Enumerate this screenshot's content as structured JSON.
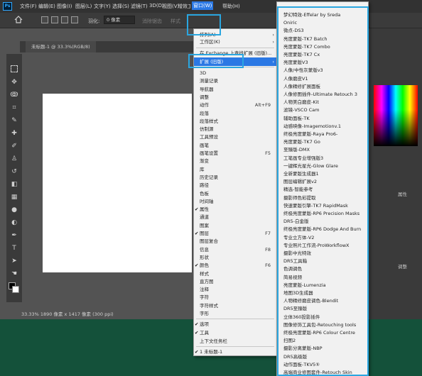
{
  "app": {
    "logo": "Ps"
  },
  "menubar": [
    "文件(F)",
    "编辑(E)",
    "图像(I)",
    "图层(L)",
    "文字(Y)",
    "选择(S)",
    "滤镜(T)",
    "3D(D)",
    "视图(V)",
    "增效工具",
    "窗口(W)",
    "帮助(H)"
  ],
  "options": {
    "feather_label": "羽化:",
    "feather_value": "0 像素",
    "antialias": "消除锯齿",
    "style": "样式"
  },
  "document": {
    "tab": "未标题-1 @ 33.3%(RGB/8)",
    "status": "33.33% 1890 像素 x 1417 像素 (300 ppi)"
  },
  "icons": [
    "home-icon",
    "marquee-icon",
    "move-icon",
    "lasso-icon",
    "crop-icon",
    "eyedropper-icon",
    "brush-icon",
    "stamp-icon",
    "eraser-icon",
    "gradient-icon",
    "pen-icon",
    "type-icon",
    "hand-icon",
    "zoom-icon"
  ],
  "right_panel": {
    "label": "属性",
    "label2": "调整"
  },
  "window_menu": {
    "top": [
      {
        "label": "排列(A)",
        "arrow": "›"
      },
      {
        "label": "工作区(K)",
        "arrow": "›"
      },
      {
        "label": "在 Exchange 上查找扩展 (旧版)..."
      },
      {
        "label": "扩展 (旧版)",
        "arrow": "›",
        "highlight": true
      }
    ],
    "panels": [
      {
        "label": "3D"
      },
      {
        "label": "测量记录"
      },
      {
        "label": "导航器"
      },
      {
        "label": "调整"
      },
      {
        "label": "动作",
        "shortcut": "Alt+F9"
      },
      {
        "label": "段落"
      },
      {
        "label": "段落样式"
      },
      {
        "label": "仿制源"
      },
      {
        "label": "工具预设"
      },
      {
        "label": "画笔"
      },
      {
        "label": "画笔设置",
        "shortcut": "F5"
      },
      {
        "label": "渐变"
      },
      {
        "label": "库"
      },
      {
        "label": "历史记录"
      },
      {
        "label": "路径"
      },
      {
        "label": "色板"
      },
      {
        "label": "时间轴"
      },
      {
        "label": "属性",
        "checked": true
      },
      {
        "label": "通道"
      },
      {
        "label": "图案"
      },
      {
        "label": "图层",
        "shortcut": "F7",
        "checked": true
      },
      {
        "label": "图层复合"
      },
      {
        "label": "信息",
        "shortcut": "F8"
      },
      {
        "label": "形状"
      },
      {
        "label": "颜色",
        "shortcut": "F6",
        "checked": true
      },
      {
        "label": "样式"
      },
      {
        "label": "直方图"
      },
      {
        "label": "注释"
      },
      {
        "label": "字符"
      },
      {
        "label": "字符样式"
      },
      {
        "label": "字形"
      }
    ],
    "bottom": [
      {
        "label": "选项",
        "checked": true
      },
      {
        "label": "工具",
        "checked": true
      },
      {
        "label": "上下文任务栏"
      }
    ],
    "docs": [
      {
        "label": "1 未标题-1",
        "checked": true
      }
    ],
    "check": "✔"
  },
  "extensions_menu": [
    "梦幻特效-Effelar by Sreda",
    "Oniric",
    "微点-DS3",
    "亮度蒙版-TK7 Batch",
    "亮度蒙版-TK7 Combo",
    "亮度蒙版-TK7 Cx",
    "亮度蒙版V3",
    "人像/中性灰蒙版v3",
    "人像磨皮V1",
    "人像精修扩展面板",
    "人像修图插件-Ultimate Retouch 3",
    "人物美白磨皮-Kit",
    "滤镜-VSCO Cam",
    "辅助面板-TK",
    "动感映像-Imagemotionv.1",
    "终极亮度蒙版-Raya Pro6-",
    "亮度蒙版-TK7 Go",
    "至臻版-DMX",
    "工笔画专业增强版3",
    "一键辉光星光-Glow Glare",
    "全新蒙版生成器1",
    "图层编辑扩展v2",
    "精选-智能参考",
    "摄影师色彩提取",
    "快速蒙版引擎-TK7 RapidMask",
    "终极亮度蒙版-RP6 Precision Masks",
    "DR5-白金版",
    "终极亮度蒙版-RP6 Dodge And Burn",
    "专业立方体-V2",
    "专业照片工作流-ProWorkflowX",
    "摄影中光特效",
    "DR5工具箱",
    "色调调色",
    "简易视频",
    "亮度蒙版-Lumenzia",
    "地图3D生成器",
    "人物精修磨皮调色-Blendit",
    "DR5至臻版",
    "立体360投影插件",
    "图像修饰工具包-Retouching tools",
    "终极亮度蒙版-RP6 Colour Centre",
    "扫图2",
    "摄影分离蒙版-NBP",
    "DR5高级版",
    "动作面板-TKV5⑤",
    "高端商业修图套件-Retouch Skin"
  ]
}
